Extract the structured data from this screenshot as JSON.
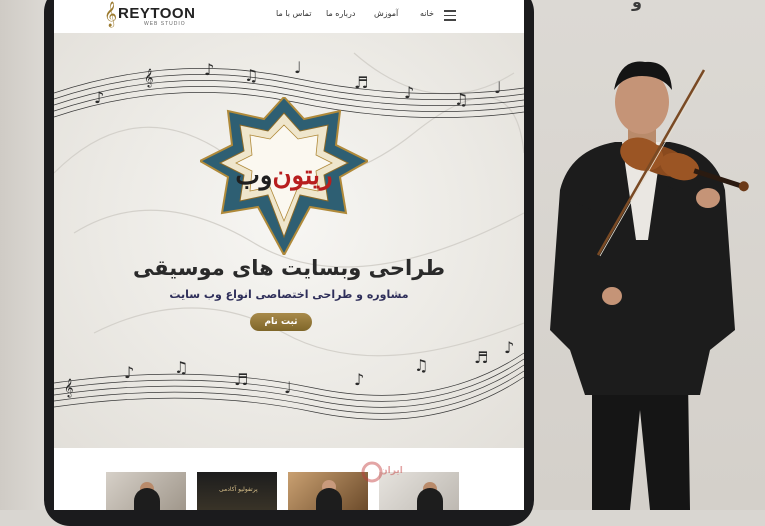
{
  "page": {
    "corner_text": "و"
  },
  "header": {
    "logo_name": "REYTOON",
    "logo_sub": "WEB STUDIO",
    "nav": {
      "home": "خانه",
      "tutorial": "آموزش",
      "about": "درباره ما",
      "contact": "تماس با ما"
    }
  },
  "hero": {
    "emblem_part1": "وب",
    "emblem_part2": "ریتون",
    "title": "طراحی وبسایت های موسیقی",
    "subtitle": "مشاوره و طراحی اختصاصی انواع وب سایت",
    "cta": "ثبت نام"
  },
  "thumbnails": {
    "t2_caption": "پرتفولیو آکادمی"
  },
  "watermark": {
    "text": "ایران"
  },
  "colors": {
    "accent_gold": "#9b7a2e",
    "emblem_red": "#b81e1e",
    "device_frame": "#1b1b1d"
  },
  "icons": {
    "menu": "hamburger-menu-icon",
    "logo": "treble-clef-icon"
  }
}
